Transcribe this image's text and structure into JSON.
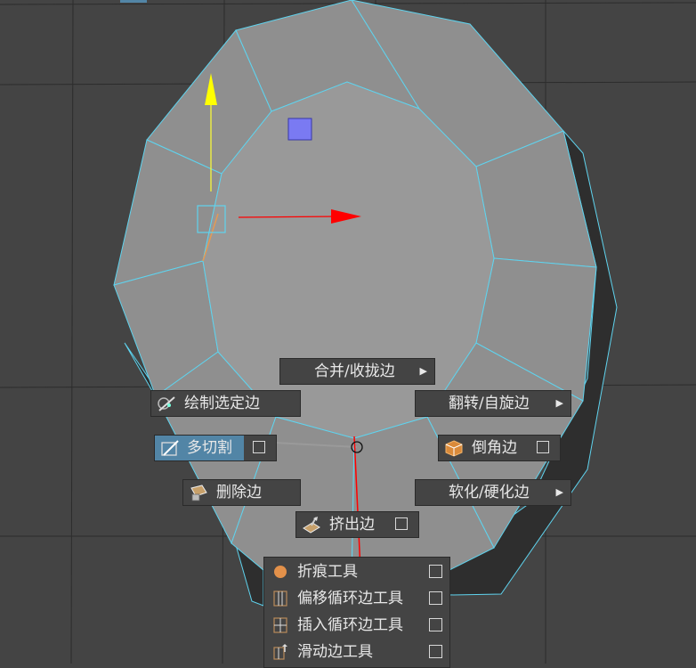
{
  "marking_menu": {
    "north": {
      "label": "合并/收拢边",
      "has_submenu": true
    },
    "northwest": {
      "label": "绘制选定边",
      "icon": "paint-select-edge-icon"
    },
    "northeast": {
      "label": "翻转/自旋边",
      "has_submenu": true
    },
    "west": {
      "label": "多切割",
      "icon": "multi-cut-icon",
      "has_option_box": true,
      "highlighted": true
    },
    "east": {
      "label": "倒角边",
      "icon": "bevel-icon",
      "has_option_box": true
    },
    "southwest": {
      "label": "删除边",
      "icon": "delete-edge-icon"
    },
    "southeast": {
      "label": "软化/硬化边",
      "has_submenu": true
    },
    "south": {
      "label": "挤出边",
      "icon": "extrude-icon",
      "has_option_box": true
    }
  },
  "submenu": {
    "items": [
      {
        "label": "折痕工具",
        "icon": "crease-tool-icon",
        "has_option_box": true
      },
      {
        "label": "偏移循环边工具",
        "icon": "offset-edge-loop-icon",
        "has_option_box": true
      },
      {
        "label": "插入循环边工具",
        "icon": "insert-edge-loop-icon",
        "has_option_box": true
      },
      {
        "label": "滑动边工具",
        "icon": "slide-edge-icon",
        "has_option_box": true
      }
    ]
  },
  "colors": {
    "viewport_bg": "#444444",
    "mesh_face": "#8f8f8f",
    "mesh_edge": "#5fd3ee",
    "highlight": "#5285a6",
    "x_axis": "#ff0000",
    "y_axis": "#ffff00"
  }
}
